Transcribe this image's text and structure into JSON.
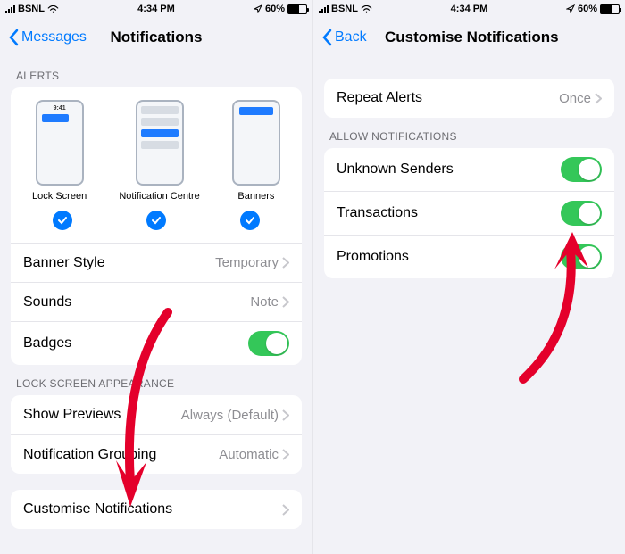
{
  "status": {
    "carrier": "BSNL",
    "time": "4:34 PM",
    "battery_pct": "60%"
  },
  "left": {
    "back_label": "Messages",
    "title": "Notifications",
    "alerts_header": "ALERTS",
    "previews": {
      "lock_screen": "Lock Screen",
      "notification_centre": "Notification Centre",
      "banners": "Banners",
      "phone_time": "9:41"
    },
    "rows": {
      "banner_style": {
        "label": "Banner Style",
        "value": "Temporary"
      },
      "sounds": {
        "label": "Sounds",
        "value": "Note"
      },
      "badges": {
        "label": "Badges",
        "on": true
      }
    },
    "lock_appearance_header": "LOCK SCREEN APPEARANCE",
    "show_previews": {
      "label": "Show Previews",
      "value": "Always (Default)"
    },
    "notification_grouping": {
      "label": "Notification Grouping",
      "value": "Automatic"
    },
    "customise": {
      "label": "Customise Notifications"
    }
  },
  "right": {
    "back_label": "Back",
    "title": "Customise Notifications",
    "repeat_alerts": {
      "label": "Repeat Alerts",
      "value": "Once"
    },
    "allow_header": "ALLOW NOTIFICATIONS",
    "toggles": {
      "unknown": {
        "label": "Unknown Senders",
        "on": true
      },
      "transactions": {
        "label": "Transactions",
        "on": true
      },
      "promotions": {
        "label": "Promotions",
        "on": true
      }
    }
  }
}
